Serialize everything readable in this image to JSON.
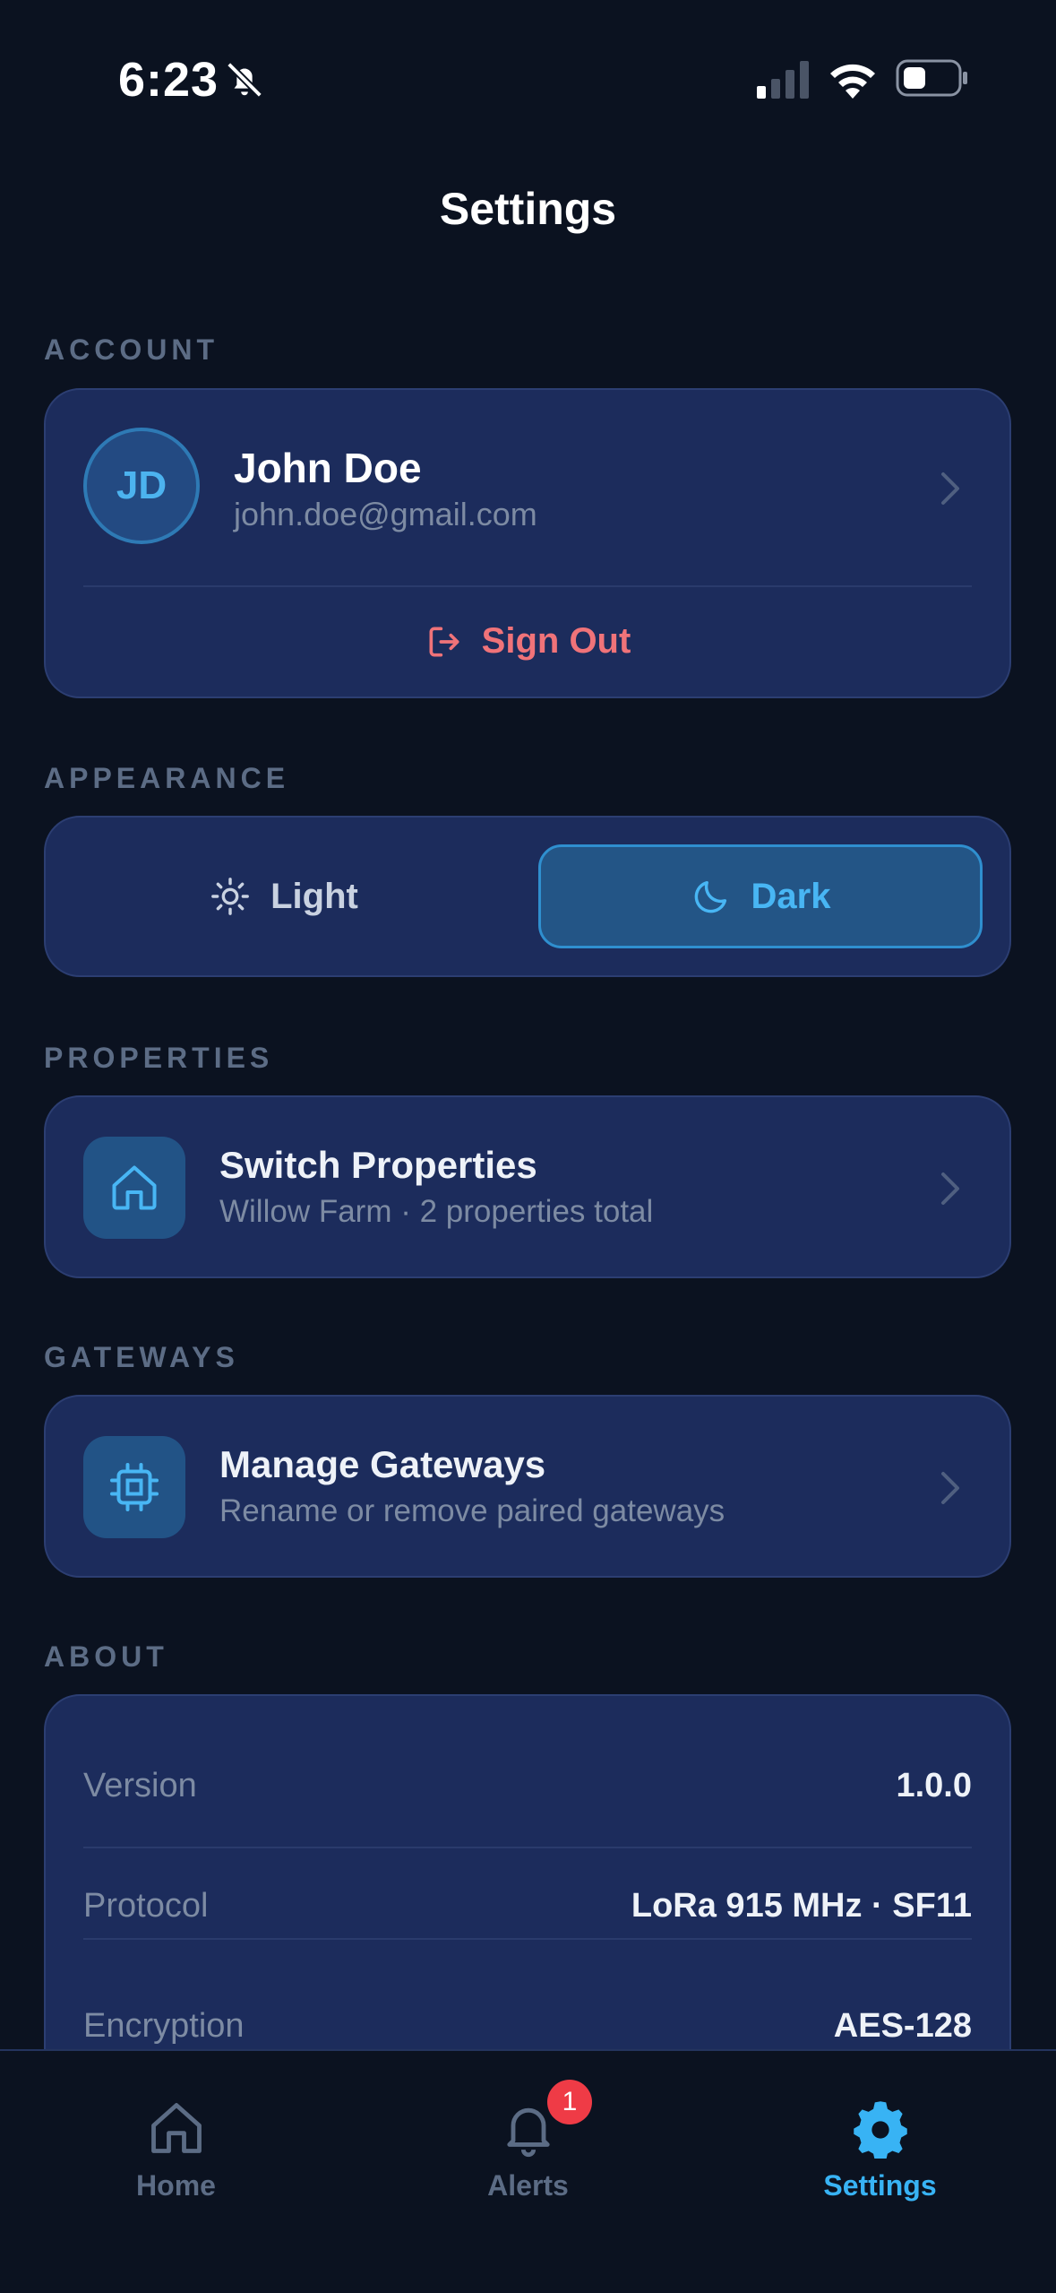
{
  "status_bar": {
    "time": "6:23"
  },
  "header": {
    "title": "Settings"
  },
  "sections": {
    "account": "ACCOUNT",
    "appearance": "APPEARANCE",
    "properties": "PROPERTIES",
    "gateways": "GATEWAYS",
    "about": "ABOUT"
  },
  "account": {
    "initials": "JD",
    "name": "John Doe",
    "email": "john.doe@gmail.com",
    "sign_out": "Sign Out"
  },
  "appearance": {
    "options": [
      {
        "label": "Light",
        "icon": "sun-icon",
        "selected": false
      },
      {
        "label": "Dark",
        "icon": "moon-icon",
        "selected": true
      }
    ]
  },
  "properties": {
    "title": "Switch Properties",
    "subtitle": "Willow Farm · 2 properties total",
    "icon": "house-icon"
  },
  "gateways": {
    "title": "Manage Gateways",
    "subtitle": "Rename or remove paired gateways",
    "icon": "chip-icon"
  },
  "about": {
    "rows": [
      {
        "key": "Version",
        "value": "1.0.0"
      },
      {
        "key": "Protocol",
        "value": "LoRa 915 MHz · SF11"
      },
      {
        "key": "Encryption",
        "value": "AES-128"
      }
    ]
  },
  "tabbar": {
    "tabs": [
      {
        "label": "Home",
        "icon": "home-icon",
        "active": false
      },
      {
        "label": "Alerts",
        "icon": "bell-icon",
        "active": false,
        "badge": "1"
      },
      {
        "label": "Settings",
        "icon": "gear-icon",
        "active": true
      }
    ]
  },
  "colors": {
    "background": "#0b1220",
    "card": "#1c2c5c",
    "accent": "#48b6f4",
    "danger": "#f07379",
    "badge": "#ef3b46"
  }
}
